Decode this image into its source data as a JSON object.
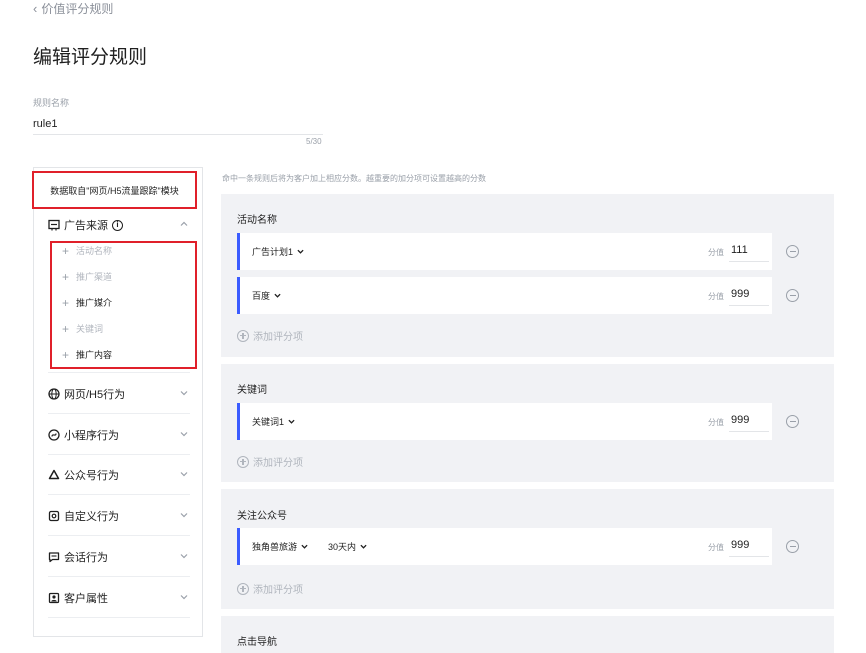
{
  "nav": {
    "back_label": "价值评分规则"
  },
  "page": {
    "title": "编辑评分规则"
  },
  "rule_name": {
    "label": "规则名称",
    "value": "rule1",
    "count": "5/30"
  },
  "source_panel": {
    "note": "数据取自\"网页/H5流量跟踪\"模块",
    "groups": [
      {
        "label": "广告来源",
        "icon": "ad-icon",
        "expanded": true,
        "items": [
          {
            "label": "活动名称",
            "state": "used"
          },
          {
            "label": "推广渠道",
            "state": "used"
          },
          {
            "label": "推广媒介",
            "state": "available"
          },
          {
            "label": "关键词",
            "state": "used"
          },
          {
            "label": "推广内容",
            "state": "available"
          }
        ]
      },
      {
        "label": "网页/H5行为",
        "icon": "globe-icon"
      },
      {
        "label": "小程序行为",
        "icon": "miniprogram-icon"
      },
      {
        "label": "公众号行为",
        "icon": "official-account-icon"
      },
      {
        "label": "自定义行为",
        "icon": "custom-event-icon"
      },
      {
        "label": "会话行为",
        "icon": "chat-icon"
      },
      {
        "label": "客户属性",
        "icon": "profile-icon"
      }
    ]
  },
  "rules": {
    "hint": "命中一条规则后将为客户加上相应分数。越重要的加分项可设置越高的分数",
    "score_label": "分值",
    "add_label": "添加评分项",
    "sections": [
      {
        "title": "活动名称",
        "rows": [
          {
            "select": "广告计划1",
            "score": "111"
          },
          {
            "select": "百度",
            "score": "999"
          }
        ]
      },
      {
        "title": "关键词",
        "rows": [
          {
            "select": "关键词1",
            "score": "999"
          }
        ]
      },
      {
        "title": "关注公众号",
        "rows": [
          {
            "select": "独角兽旅游",
            "select2": "30天内",
            "score": "999"
          }
        ]
      },
      {
        "title": "点击导航"
      }
    ]
  },
  "colors": {
    "accent": "#3b5cff",
    "highlight": "#e0202a",
    "card_bg": "#f1f2f5"
  }
}
